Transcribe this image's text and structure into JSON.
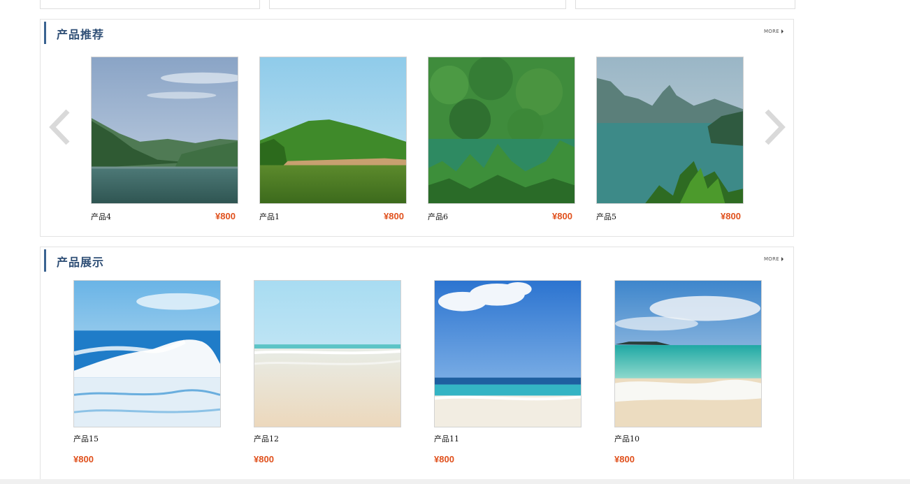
{
  "recommend": {
    "title": "产品推荐",
    "more": "MORE",
    "items": [
      {
        "name": "产品4",
        "price": "¥800"
      },
      {
        "name": "产品1",
        "price": "¥800"
      },
      {
        "name": "产品6",
        "price": "¥800"
      },
      {
        "name": "产品5",
        "price": "¥800"
      }
    ]
  },
  "showcase": {
    "title": "产品展示",
    "more": "MORE",
    "items": [
      {
        "name": "产品15",
        "price": "¥800"
      },
      {
        "name": "产品12",
        "price": "¥800"
      },
      {
        "name": "产品11",
        "price": "¥800"
      },
      {
        "name": "产品10",
        "price": "¥800"
      }
    ]
  },
  "icons": {
    "prev": "chevron-left-icon",
    "next": "chevron-right-icon",
    "more": "triangle-right-icon"
  },
  "colors": {
    "accent": "#3a6391",
    "price": "#e0501c",
    "title": "#2f4f76"
  }
}
